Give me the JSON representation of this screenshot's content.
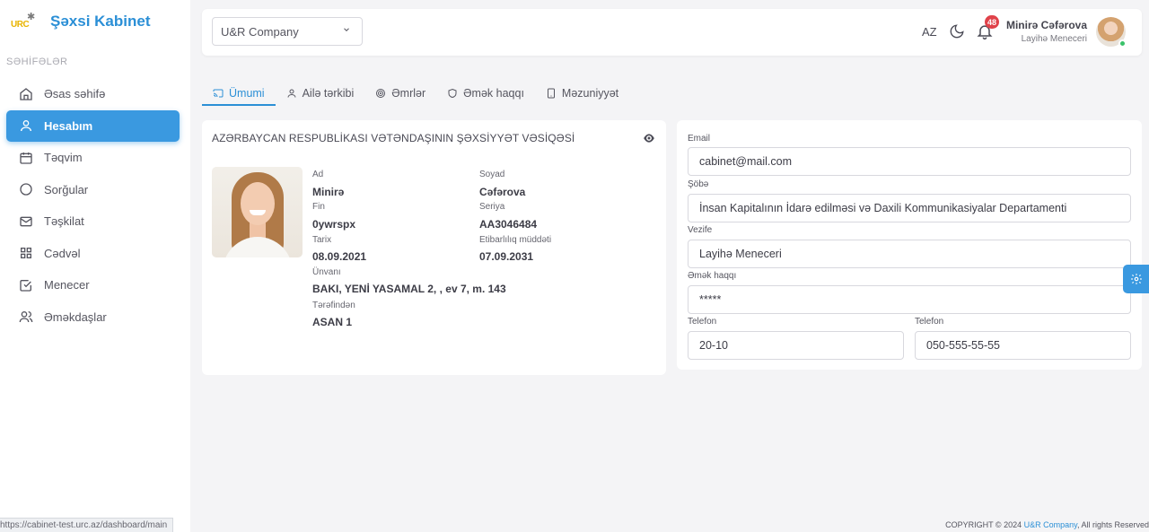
{
  "brand": {
    "logo_text": "URC",
    "title": "Şəxsi Kabinet"
  },
  "sidebar": {
    "section_label": "SƏHİFƏLƏR",
    "items": [
      {
        "label": "Əsas səhifə",
        "icon": "home-icon"
      },
      {
        "label": "Hesabım",
        "icon": "user-icon",
        "active": true
      },
      {
        "label": "Təqvim",
        "icon": "calendar-icon"
      },
      {
        "label": "Sorğular",
        "icon": "circle-icon"
      },
      {
        "label": "Təşkilat",
        "icon": "mail-icon"
      },
      {
        "label": "Cədvəl",
        "icon": "grid-icon"
      },
      {
        "label": "Menecer",
        "icon": "checkbox-icon"
      },
      {
        "label": "Əməkdaşlar",
        "icon": "users-icon"
      }
    ]
  },
  "header": {
    "company_select": "U&R Company",
    "language": "AZ",
    "notification_count": "48",
    "user_name": "Minirə Cəfərova",
    "user_role": "Layihə Meneceri"
  },
  "tabs": [
    {
      "label": "Ümumi",
      "icon": "cast-icon",
      "active": true
    },
    {
      "label": "Ailə tərkibi",
      "icon": "user-icon"
    },
    {
      "label": "Əmrlər",
      "icon": "target-icon"
    },
    {
      "label": "Əmək haqqı",
      "icon": "shield-icon"
    },
    {
      "label": "Məzuniyyət",
      "icon": "tablet-icon"
    }
  ],
  "id_card": {
    "title": "AZƏRBAYCAN RESPUBLİKASI VƏTƏNDAŞININ ŞƏXSİYYƏT VƏSİQƏSİ",
    "ad_label": "Ad",
    "ad": "Minirə",
    "soyad_label": "Soyad",
    "soyad": "Cəfərova",
    "fin_label": "Fin",
    "fin": "0ywrspx",
    "seriya_label": "Seriya",
    "seriya": "AA3046484",
    "tarix_label": "Tarix",
    "tarix": "08.09.2021",
    "etibarliliq_label": "Etibarlılıq müddəti",
    "etibarliliq": "07.09.2031",
    "unvan_label": "Ünvanı",
    "unvan": "BAKI, YENİ YASAMAL 2, , ev 7, m. 143",
    "terefinden_label": "Tərəfindən",
    "terefinden": "ASAN 1"
  },
  "form": {
    "email_label": "Email",
    "email": "cabinet@mail.com",
    "sobe_label": "Şöbə",
    "sobe": "İnsan Kapitalının İdarə edilməsi və Daxili Kommunikasiyalar Departamenti",
    "vezife_label": "Vezife",
    "vezife": "Layihə Meneceri",
    "emek_haqqi_label": "Əmək haqqı",
    "emek_haqqi": "*****",
    "telefon1_label": "Telefon",
    "telefon1": "20-10",
    "telefon2_label": "Telefon",
    "telefon2": "050-555-55-55"
  },
  "footer": {
    "prefix": "COPYRIGHT © 2024 ",
    "company": "U&R Company",
    "suffix": ", All rights Reserved"
  },
  "statusbar": {
    "url": "https://cabinet-test.urc.az/dashboard/main"
  },
  "colors": {
    "accent": "#3a99e0",
    "brand": "#2b8fd6",
    "badge": "#e0424a",
    "online": "#3ac26a"
  }
}
